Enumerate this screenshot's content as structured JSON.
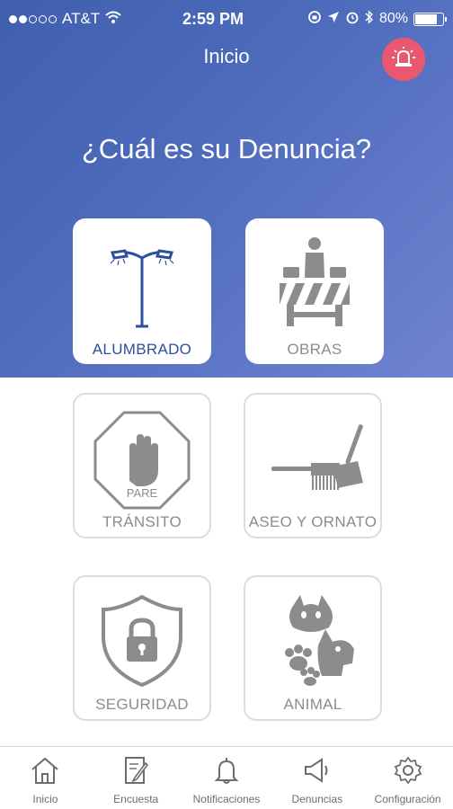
{
  "status_bar": {
    "carrier": "AT&T",
    "time": "2:59 PM",
    "battery": "80%",
    "battery_level": 0.8,
    "signal_bars_filled": 2,
    "signal_bars_total": 5
  },
  "nav": {
    "title": "Inicio",
    "alarm_icon": "siren-icon",
    "alarm_color": "#e9586f"
  },
  "main": {
    "question": "¿Cuál es su Denuncia?",
    "accent_color": "#2e4f9e",
    "categories": [
      {
        "label": "ALUMBRADO",
        "icon": "streetlight-icon",
        "selected": true
      },
      {
        "label": "OBRAS",
        "icon": "roadwork-icon",
        "selected": false
      },
      {
        "label": "TRÁNSITO",
        "icon": "stop-sign-icon",
        "sign_text": "PARE",
        "selected": false
      },
      {
        "label": "ASEO Y ORNATO",
        "icon": "broom-dustpan-icon",
        "selected": false
      },
      {
        "label": "SEGURIDAD",
        "icon": "lock-shield-icon",
        "selected": false
      },
      {
        "label": "ANIMAL",
        "icon": "cat-dog-icon",
        "selected": false
      }
    ]
  },
  "tabs": [
    {
      "label": "Inicio",
      "icon": "home-icon"
    },
    {
      "label": "Encuesta",
      "icon": "survey-icon"
    },
    {
      "label": "Notificaciones",
      "icon": "bell-icon"
    },
    {
      "label": "Denuncias",
      "icon": "megaphone-icon"
    },
    {
      "label": "Configuración",
      "icon": "gear-icon"
    }
  ]
}
